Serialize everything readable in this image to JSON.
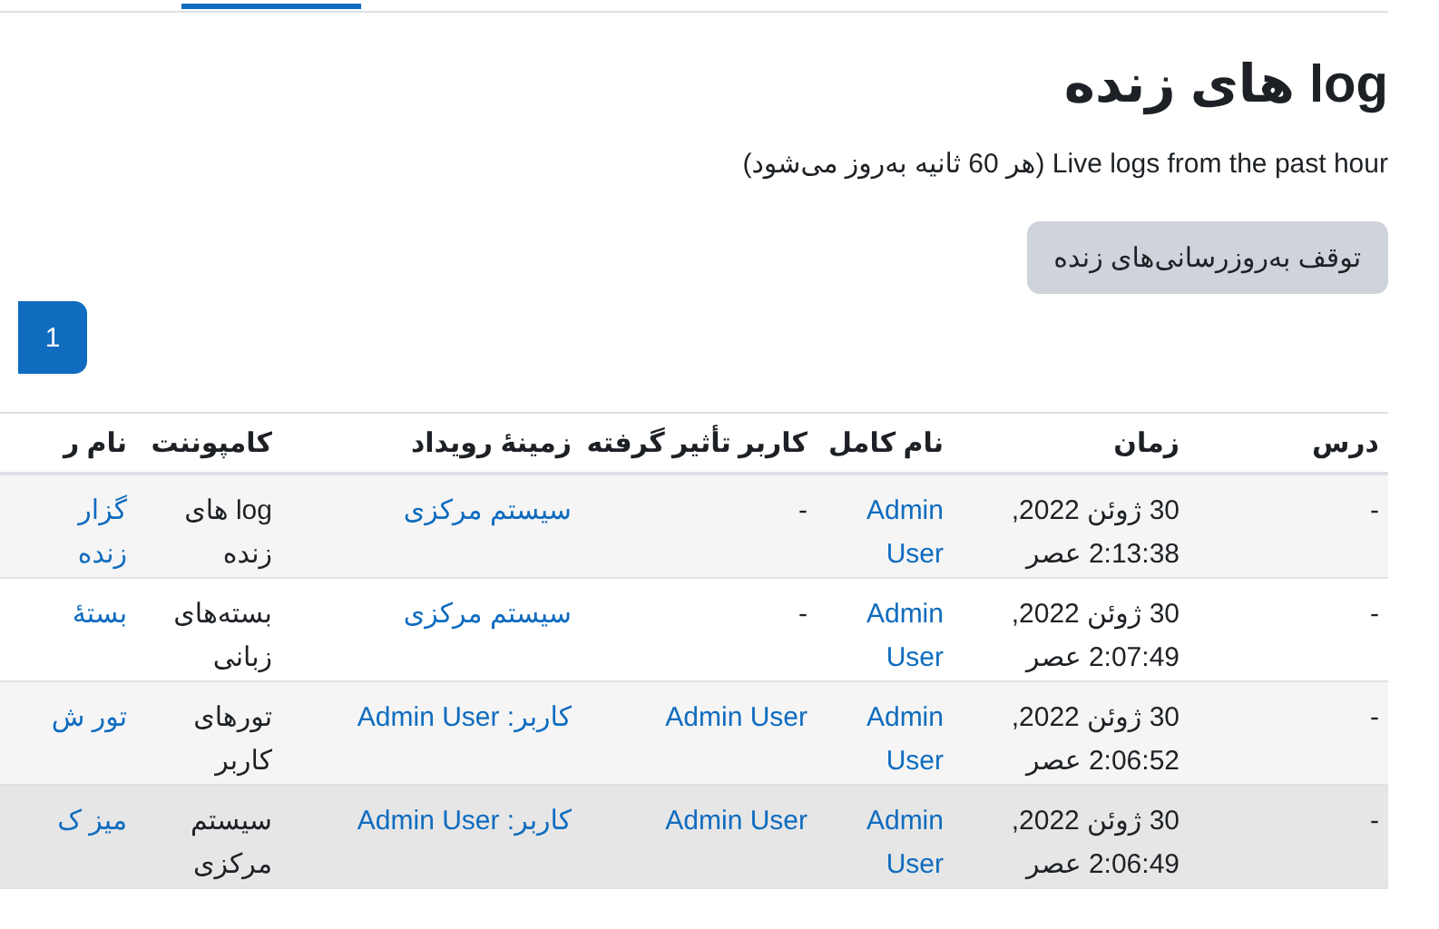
{
  "title": "log های زنده",
  "description": "Live logs from the past hour (هر 60 ثانیه به‌روز می‌شود)",
  "pause_button": "توقف به‌روزرسانی‌های زنده",
  "pagination": [
    {
      "label": "1",
      "selected": true
    }
  ],
  "table": {
    "columns": [
      "درس",
      "زمان",
      "نام کامل",
      "کاربر تأثیر گرفته",
      "زمینهٔ رویداد",
      "کامپوننت",
      "نام ر"
    ],
    "rows": [
      {
        "highlighted": false,
        "cells": [
          {
            "text": "-",
            "kind": "text"
          },
          {
            "text": "30 ژوئن 2022,\n2:13:38 عصر",
            "kind": "text"
          },
          {
            "text": "Admin\nUser",
            "kind": "link"
          },
          {
            "text": "-",
            "kind": "text"
          },
          {
            "text": "سیستم مرکزی",
            "kind": "link"
          },
          {
            "text": "log های\nزنده",
            "kind": "text"
          },
          {
            "text": "گزار\nزنده",
            "kind": "link"
          }
        ]
      },
      {
        "highlighted": false,
        "cells": [
          {
            "text": "-",
            "kind": "text"
          },
          {
            "text": "30 ژوئن 2022,\n2:07:49 عصر",
            "kind": "text"
          },
          {
            "text": "Admin\nUser",
            "kind": "link"
          },
          {
            "text": "-",
            "kind": "text"
          },
          {
            "text": "سیستم مرکزی",
            "kind": "link"
          },
          {
            "text": "بسته‌های\nزبانی",
            "kind": "text"
          },
          {
            "text": "بستهٔ",
            "kind": "link"
          }
        ]
      },
      {
        "highlighted": false,
        "cells": [
          {
            "text": "-",
            "kind": "text"
          },
          {
            "text": "30 ژوئن 2022,\n2:06:52 عصر",
            "kind": "text"
          },
          {
            "text": "Admin\nUser",
            "kind": "link"
          },
          {
            "text": "Admin User",
            "kind": "link"
          },
          {
            "text": "کاربر: Admin User",
            "kind": "link"
          },
          {
            "text": "تورهای\nکاربر",
            "kind": "text"
          },
          {
            "text": "تور ش",
            "kind": "link"
          }
        ]
      },
      {
        "highlighted": true,
        "cells": [
          {
            "text": "-",
            "kind": "text"
          },
          {
            "text": "30 ژوئن 2022,\n2:06:49 عصر",
            "kind": "text"
          },
          {
            "text": "Admin\nUser",
            "kind": "link"
          },
          {
            "text": "Admin User",
            "kind": "link"
          },
          {
            "text": "کاربر: Admin User",
            "kind": "link"
          },
          {
            "text": "سیستم\nمرکزی",
            "kind": "text"
          },
          {
            "text": "میز ک",
            "kind": "link"
          }
        ]
      }
    ]
  }
}
